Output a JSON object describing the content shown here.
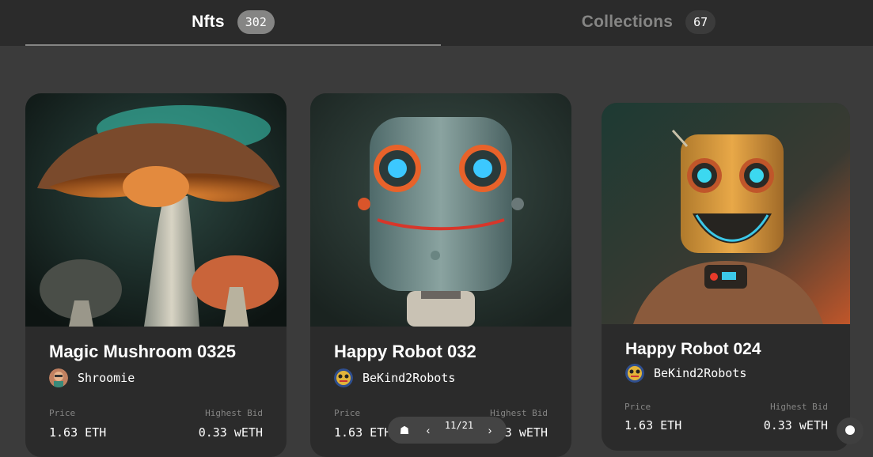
{
  "tabs": [
    {
      "label": "Nfts",
      "count": "302",
      "active": true
    },
    {
      "label": "Collections",
      "count": "67",
      "active": false
    }
  ],
  "cards": [
    {
      "title": "Magic Mushroom 0325",
      "artist": "Shroomie",
      "price_label": "Price",
      "price": "1.63 ETH",
      "bid_label": "Highest Bid",
      "bid": "0.33 wETH"
    },
    {
      "title": "Happy Robot 032",
      "artist": "BeKind2Robots",
      "price_label": "Price",
      "price": "1.63 ETH",
      "bid_label": "Highest Bid",
      "bid": "0.33 wETH"
    },
    {
      "title": "Happy Robot 024",
      "artist": "BeKind2Robots",
      "price_label": "Price",
      "price": "1.63 ETH",
      "bid_label": "Highest Bid",
      "bid": "0.33 wETH"
    }
  ],
  "viewer": {
    "page": "11/21"
  },
  "colors": {
    "background": "#3b3b3b",
    "panel": "#2b2b2b",
    "muted": "#858584",
    "text": "#ffffff"
  },
  "icons": [
    "home-icon",
    "chevron-left-icon",
    "chevron-right-icon",
    "chat-icon"
  ]
}
